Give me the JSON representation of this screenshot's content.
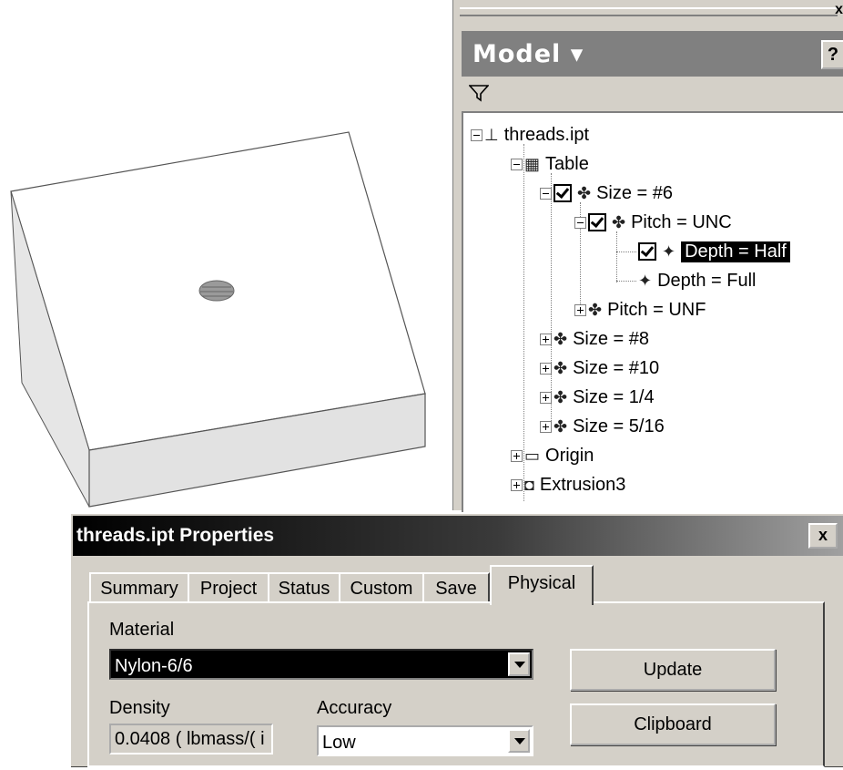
{
  "browser": {
    "close_glyph": "x",
    "title": "Model ▾",
    "help": "?",
    "filter_icon": "filter-icon",
    "tree": [
      {
        "label": "threads.ipt",
        "icon": "part-icon"
      },
      {
        "label": "Table",
        "icon": "table-icon"
      },
      {
        "label": "Size = #6",
        "icon": "member-icon",
        "checked": true
      },
      {
        "label": "Pitch = UNC",
        "icon": "member-icon",
        "checked": true
      },
      {
        "label": "Depth = Half",
        "icon": "member-icon",
        "checked": true,
        "selected": true
      },
      {
        "label": "Depth = Full",
        "icon": "member-icon"
      },
      {
        "label": "Pitch = UNF",
        "icon": "member-icon"
      },
      {
        "label": "Size = #8",
        "icon": "member-icon"
      },
      {
        "label": "Size = #10",
        "icon": "member-icon"
      },
      {
        "label": "Size = 1/4",
        "icon": "member-icon"
      },
      {
        "label": "Size = 5/16",
        "icon": "member-icon"
      },
      {
        "label": "Origin",
        "icon": "folder-icon"
      },
      {
        "label": "Extrusion3",
        "icon": "extrusion-icon"
      }
    ]
  },
  "dialog": {
    "title": "threads.ipt Properties",
    "close_glyph": "x",
    "tabs": [
      "Summary",
      "Project",
      "Status",
      "Custom",
      "Save",
      "Physical"
    ],
    "active_tab": "Physical",
    "material_label": "Material",
    "material_value": "Nylon-6/6",
    "density_label": "Density",
    "density_value": "0.0408 ( lbmass/( i",
    "accuracy_label": "Accuracy",
    "accuracy_value": "Low",
    "update_label": "Update",
    "clipboard_label": "Clipboard"
  }
}
